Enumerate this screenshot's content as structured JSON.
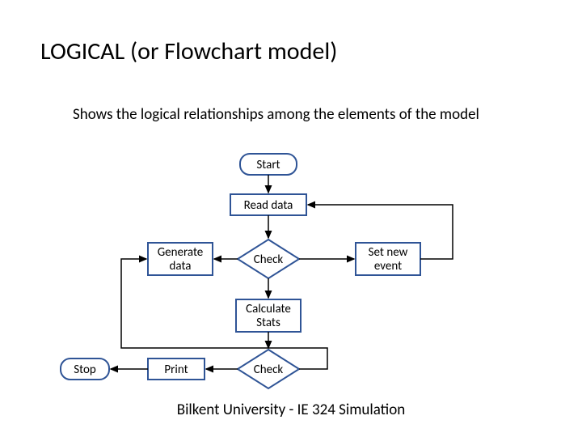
{
  "title": "LOGICAL (or Flowchart model)",
  "subtitle": "Shows the logical relationships among the elements of the model",
  "footer": "Bilkent University - IE 324 Simulation",
  "nodes": {
    "start": "Start",
    "read": "Read data",
    "generate1": "Generate",
    "generate2": "data",
    "check1": "Check",
    "setnew1": "Set new",
    "setnew2": "event",
    "calc1": "Calculate",
    "calc2": "Stats",
    "check2": "Check",
    "print": "Print",
    "stop": "Stop"
  }
}
